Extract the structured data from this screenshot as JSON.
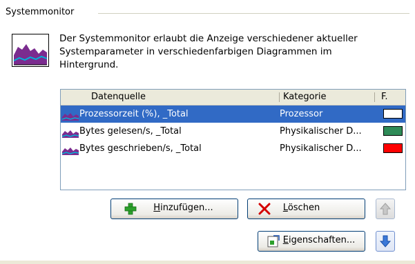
{
  "group": {
    "title": "Systemmonitor",
    "description_line1": "Der Systemmonitor erlaubt die Anzeige verschiedener aktueller",
    "description_line2": "Systemparameter in verschiedenfarbigen Diagrammen im",
    "description_line3": "Hintergrund."
  },
  "list": {
    "columns": [
      "Datenquelle",
      "Kategorie",
      "F."
    ],
    "rows": [
      {
        "source": "Prozessorzeit (%), _Total",
        "category": "Prozessor",
        "color": "#ffffff",
        "selected": true
      },
      {
        "source": "Bytes gelesen/s, _Total",
        "category": "Physikalischer D...",
        "color": "#2e8b57",
        "selected": false
      },
      {
        "source": "Bytes geschrieben/s, _Total",
        "category": "Physikalischer D...",
        "color": "#ff0000",
        "selected": false
      }
    ]
  },
  "buttons": {
    "add_mnemonic": "H",
    "add_rest": "inzufügen...",
    "delete_mnemonic": "L",
    "delete_rest": "öschen",
    "properties_first": "E",
    "properties_mnemonic": "i",
    "properties_rest": "genschaften..."
  },
  "icons": {
    "chart": "system-monitor-icon",
    "add": "green-plus-icon",
    "delete": "red-x-icon",
    "properties": "properties-icon",
    "up": "arrow-up-icon",
    "down": "arrow-down-icon"
  }
}
